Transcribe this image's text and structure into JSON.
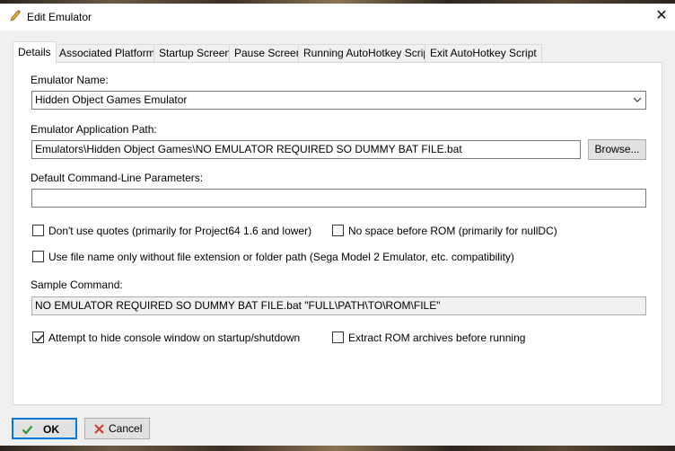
{
  "window": {
    "title": "Edit Emulator",
    "close_glyph": "✕"
  },
  "tabs": [
    {
      "label": "Details",
      "active": true
    },
    {
      "label": "Associated Platforms",
      "active": false
    },
    {
      "label": "Startup Screen",
      "active": false
    },
    {
      "label": "Pause Screen",
      "active": false
    },
    {
      "label": "Running AutoHotkey Script",
      "active": false
    },
    {
      "label": "Exit AutoHotkey Script",
      "active": false
    }
  ],
  "details": {
    "emulator_name_label": "Emulator Name:",
    "emulator_name_value": "Hidden Object Games Emulator",
    "app_path_label": "Emulator Application Path:",
    "app_path_value": "Emulators\\Hidden Object Games\\NO EMULATOR REQUIRED SO DUMMY BAT FILE.bat",
    "browse_label": "Browse...",
    "cmdline_label": "Default Command-Line Parameters:",
    "cmdline_value": "",
    "no_quotes_label": "Don't use quotes (primarily for Project64 1.6 and lower)",
    "no_quotes_checked": false,
    "no_space_label": "No space before ROM (primarily for nullDC)",
    "no_space_checked": false,
    "filename_only_label": "Use file name only without file extension or folder path (Sega Model 2 Emulator, etc. compatibility)",
    "filename_only_checked": false,
    "sample_label": "Sample Command:",
    "sample_value": "NO EMULATOR REQUIRED SO DUMMY BAT FILE.bat \"FULL\\PATH\\TO\\ROM\\FILE\"",
    "hide_console_label": "Attempt to hide console window on startup/shutdown",
    "hide_console_checked": true,
    "extract_label": "Extract ROM archives before running",
    "extract_checked": false
  },
  "footer": {
    "ok_label": "OK",
    "cancel_label": "Cancel"
  },
  "colors": {
    "ok_border": "#0078d7",
    "ok_check": "#2e9a3c",
    "cancel_x": "#d23a2a"
  },
  "icons": {
    "title": "pencil-icon",
    "dropdown": "chevron-down-icon",
    "ok": "checkmark-icon",
    "cancel": "cross-icon"
  }
}
